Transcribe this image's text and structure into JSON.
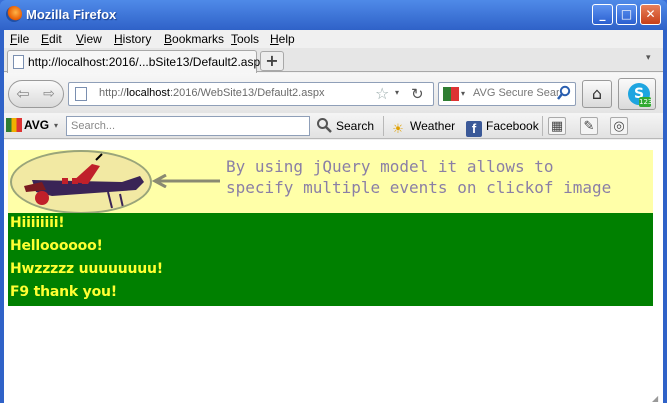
{
  "window": {
    "title": "Mozilla Firefox",
    "minimize": "_",
    "maximize": "□",
    "close": "✕"
  },
  "menu": [
    "File",
    "Edit",
    "View",
    "History",
    "Bookmarks",
    "Tools",
    "Help"
  ],
  "tab": {
    "label": "http://localhost:2016/...bSite13/Default2.aspx",
    "new_tab": "+",
    "list": "▾"
  },
  "nav": {
    "back": "⇦",
    "forward": "⇨",
    "url_prefix": "http://",
    "url_host": "localhost",
    "url_rest": ":2016/WebSite13/Default2.aspx",
    "star": "☆",
    "dropdown": "▾",
    "reload": "↻",
    "search_placeholder": "AVG Secure Sear",
    "home": "⌂",
    "skype_badge": "123"
  },
  "avg_toolbar": {
    "brand": "AVG",
    "search_placeholder": "Search...",
    "search_label": "Search",
    "weather_label": "Weather",
    "facebook_label": "Facebook"
  },
  "content": {
    "banner_lines": [
      "By using jQuery model it allows to",
      "specify multiple events on clickof image"
    ],
    "messages": [
      "Hiiiiiiii!",
      "Helloooooo!",
      "Hwzzzzz uuuuuuuu!",
      "F9 thank you!"
    ]
  },
  "colors": {
    "banner_bg": "#ffffa8",
    "message_bg": "#008000",
    "message_text": "#ffff33",
    "banner_text": "#8a7fa6"
  }
}
